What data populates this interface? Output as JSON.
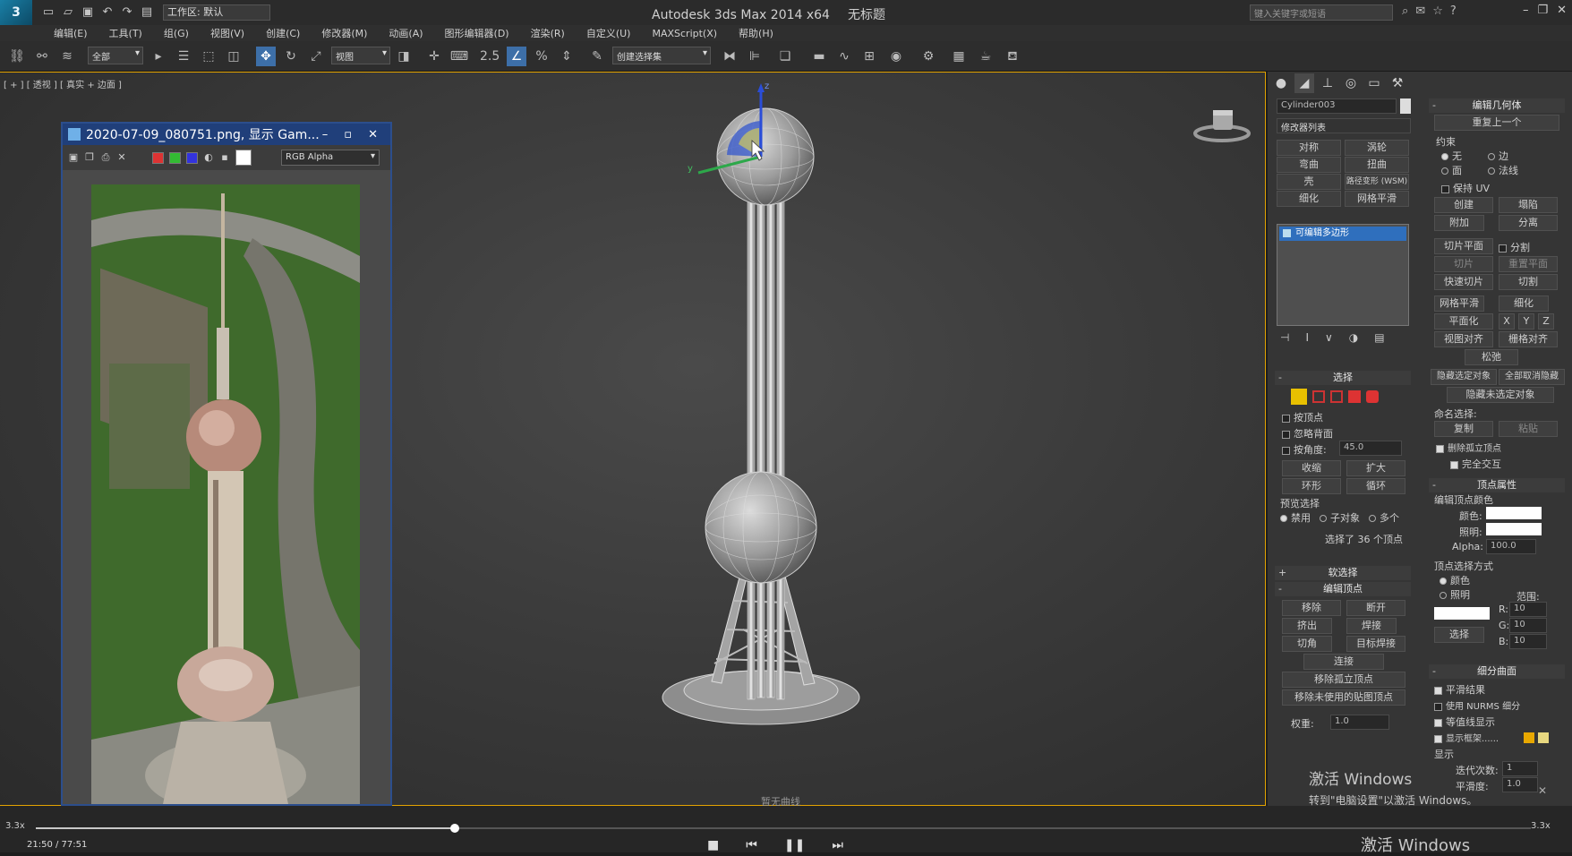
{
  "window": {
    "title": "Autodesk 3ds Max  2014 x64",
    "doc_title": "无标题",
    "workspace": "工作区: 默认",
    "search_placeholder": "键入关键字或短语"
  },
  "menu": [
    "编辑(E)",
    "工具(T)",
    "组(G)",
    "视图(V)",
    "创建(C)",
    "修改器(M)",
    "动画(A)",
    "图形编辑器(D)",
    "渲染(R)",
    "自定义(U)",
    "MAXScript(X)",
    "帮助(H)"
  ],
  "toolbar": {
    "filter": "全部",
    "ref_coord": "视图",
    "named_sel": "创建选择集",
    "snap_label": "2.5"
  },
  "viewport": {
    "label": "[ + ] [ 透视 ] [ 真实 + 边面 ]",
    "footer": "暂无曲线"
  },
  "framebuffer": {
    "title": "2020-07-09_080751.png, 显示 Gam...",
    "channel": "RGB Alpha"
  },
  "command_panel": {
    "object_name": "Cylinder003",
    "modifier_list": "修改器列表",
    "mod_buttons": [
      "对称",
      "涡轮",
      "弯曲",
      "扭曲",
      "壳",
      "路径变形 (WSM)",
      "细化",
      "网格平滑"
    ],
    "stack_item": "可编辑多边形",
    "selection": {
      "header": "选择",
      "by_vertex": "按顶点",
      "ignore_back": "忽略背面",
      "by_angle": "按角度:",
      "angle_value": "45.0",
      "shrink": "收缩",
      "grow": "扩大",
      "ring": "环形",
      "loop": "循环",
      "preview_header": "预览选择",
      "preview_opts": [
        "禁用",
        "子对象",
        "多个"
      ],
      "status": "选择了 36 个顶点"
    },
    "soft_selection": "软选择",
    "edit_vertices": {
      "header": "编辑顶点",
      "remove": "移除",
      "break": "断开",
      "extrude": "挤出",
      "weld": "焊接",
      "chamfer": "切角",
      "target_weld": "目标焊接",
      "connect": "连接",
      "remove_isolated": "移除孤立顶点",
      "remove_unused_map": "移除未使用的贴图顶点",
      "weight_label": "权重:",
      "weight_value": "1.0"
    },
    "edit_geometry": {
      "header": "编辑几何体",
      "repeat_last": "重复上一个",
      "constraints": "约束",
      "c_none": "无",
      "c_edge": "边",
      "c_face": "面",
      "c_normal": "法线",
      "preserve_uv": "保持 UV",
      "create": "创建",
      "collapse": "塌陷",
      "attach": "附加",
      "detach": "分离",
      "slice_plane": "切片平面",
      "split": "分割",
      "slice": "切片",
      "reset_plane": "重置平面",
      "quickslice": "快速切片",
      "cut": "切割",
      "meshsmooth": "网格平滑",
      "tessellate": "细化",
      "make_planar": "平面化",
      "x": "X",
      "y": "Y",
      "z": "Z",
      "view_align": "视图对齐",
      "grid_align": "栅格对齐",
      "relax": "松弛",
      "hide_sel": "隐藏选定对象",
      "unhide_all": "全部取消隐藏",
      "hide_unsel": "隐藏未选定对象",
      "named_sel": "命名选择:",
      "copy": "复制",
      "paste": "粘贴",
      "delete_isolated": "删除孤立顶点",
      "full_interactivity": "完全交互"
    },
    "vertex_props": {
      "header": "顶点属性",
      "edit_colors": "编辑顶点颜色",
      "color": "颜色:",
      "illum": "照明:",
      "alpha_label": "Alpha:",
      "alpha_value": "100.0",
      "select_by": "顶点选择方式",
      "by_color": "颜色",
      "by_illum": "照明",
      "range": "范围:",
      "r": "R:",
      "g": "G:",
      "b": "B:",
      "r_val": "10",
      "g_val": "10",
      "b_val": "10",
      "select": "选择"
    },
    "subdivision": {
      "header": "细分曲面",
      "smooth_result": "平滑结果",
      "use_nurms": "使用 NURMS 细分",
      "isoline": "等值线显示",
      "show_cage": "显示框架......",
      "display": "显示",
      "iterations": "迭代次数:",
      "iter_value": "1",
      "smoothness": "平滑度:",
      "smooth_value": "1.0"
    }
  },
  "timeline": {
    "zoom_left": "3.3x",
    "zoom_right": "3.3x",
    "time": "21:50 / 77:51",
    "progress": 0.28
  },
  "watermark": {
    "line1": "激活 Windows",
    "line2": "转到\"电脑设置\"以激活 Windows。",
    "line3": "激活 Windows"
  }
}
